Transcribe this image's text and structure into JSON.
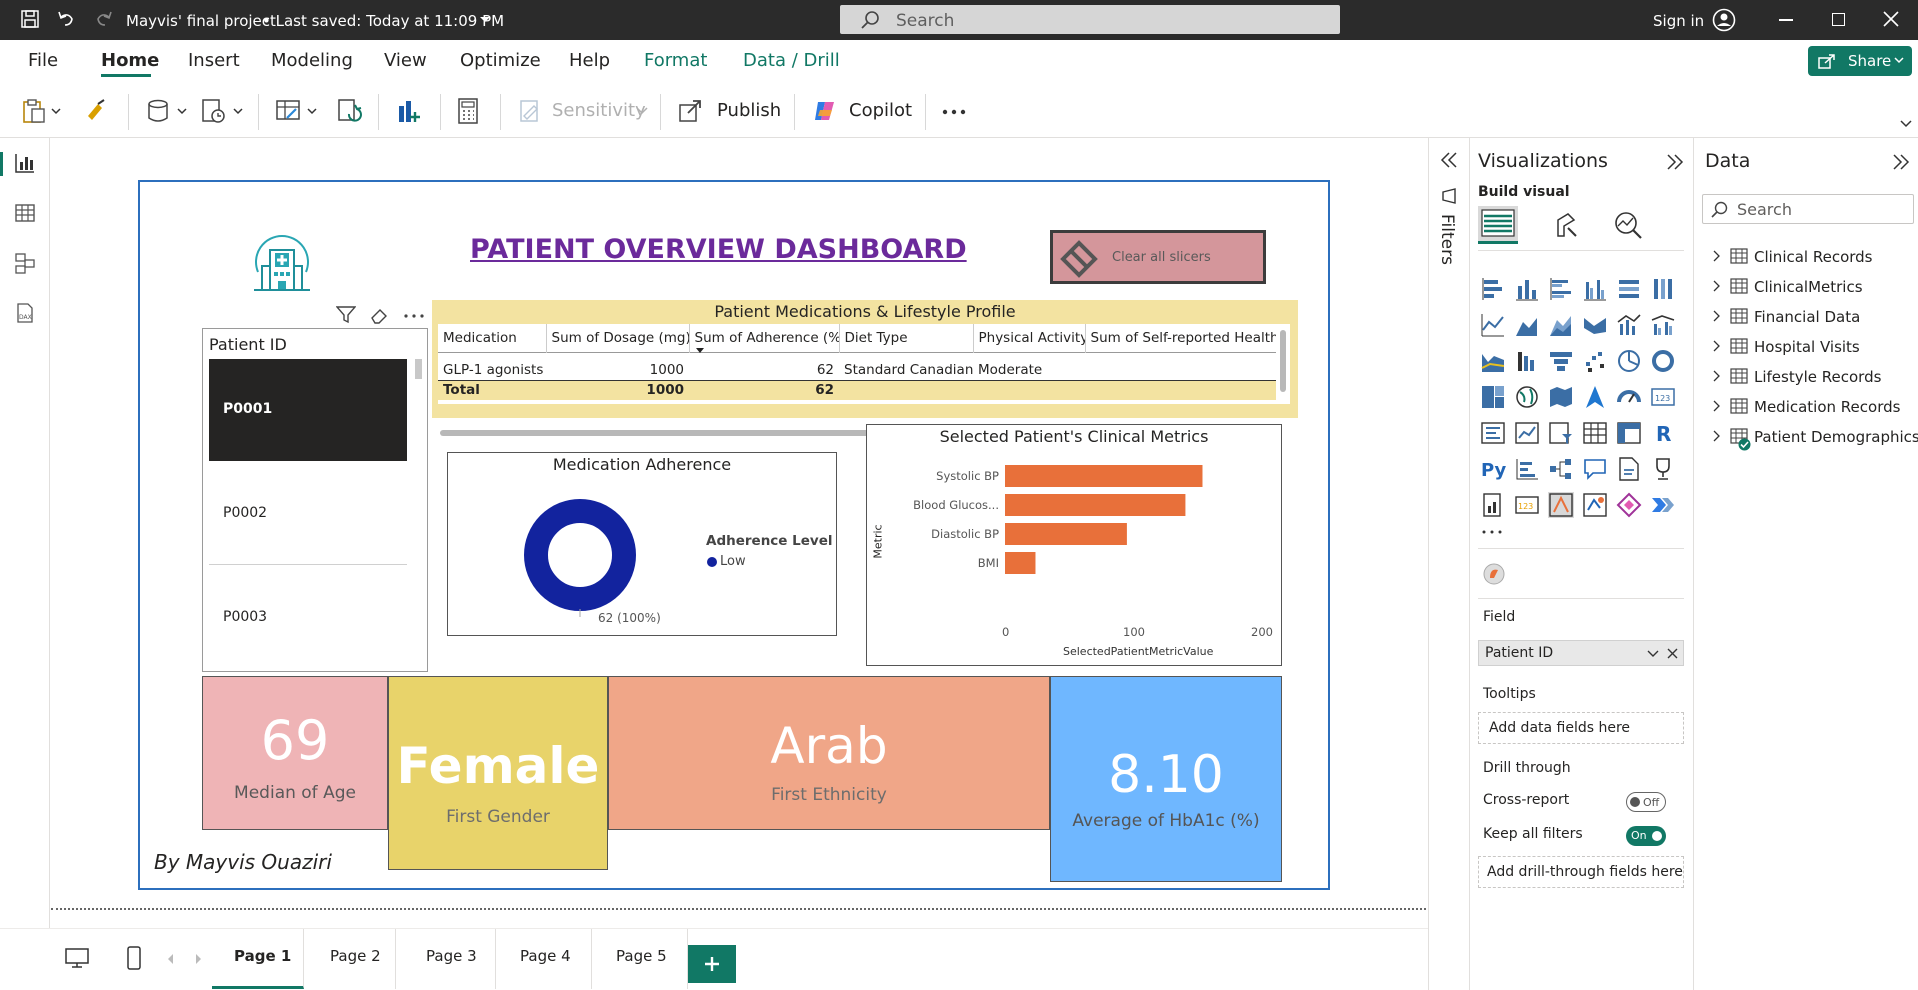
{
  "titlebar": {
    "file_title": "Mayvis' final project",
    "saved_status": "• Last saved: Today at 11:09 PM",
    "search_placeholder": "Search",
    "sign_in": "Sign in"
  },
  "menu": {
    "items": [
      "File",
      "Home",
      "Insert",
      "Modeling",
      "View",
      "Optimize",
      "Help",
      "Format",
      "Data / Drill"
    ],
    "active": "Home",
    "share": "Share"
  },
  "ribbon": {
    "sensitivity": "Sensitivity",
    "publish": "Publish",
    "copilot": "Copilot"
  },
  "report": {
    "title": "PATIENT OVERVIEW DASHBOARD",
    "clear_slicers": "Clear all slicers",
    "slicer": {
      "header": "Patient ID",
      "items": [
        "P0001",
        "P0002",
        "P0003"
      ],
      "selected": "P0001"
    },
    "table": {
      "title": "Patient Medications & Lifestyle Profile",
      "columns": [
        "Medication",
        "Sum of Dosage (mg)",
        "Sum of Adherence (%)",
        "Diet Type",
        "Physical Activity",
        "Sum of Self-reported Health ("
      ],
      "rows": [
        [
          "GLP-1 agonists",
          "1000",
          "62",
          "Standard Canadian",
          "Moderate",
          ""
        ]
      ],
      "total": [
        "Total",
        "1000",
        "62",
        "",
        "",
        ""
      ]
    },
    "donut": {
      "title": "Medication Adherence",
      "legend_title": "Adherence Level",
      "legend_item": "Low",
      "data_label": "62 (100%)"
    },
    "bar": {
      "title": "Selected Patient's Clinical Metrics",
      "y_axis_label": "Metric",
      "x_axis_label": "SelectedPatientMetricValue",
      "x_ticks": [
        "0",
        "100",
        "200"
      ],
      "categories": [
        "Systolic BP",
        "Blood Glucos...",
        "Diastolic BP",
        "BMI"
      ]
    },
    "kpis": [
      {
        "value": "69",
        "label": "Median of Age"
      },
      {
        "value": "Female",
        "label": "First Gender"
      },
      {
        "value": "Arab",
        "label": "First Ethnicity"
      },
      {
        "value": "8.10",
        "label": "Average of HbA1c (%)"
      }
    ],
    "author": "By Mayvis Ouaziri"
  },
  "chart_data": [
    {
      "type": "bar",
      "title": "Selected Patient's Clinical Metrics",
      "categories": [
        "Systolic BP",
        "Blood Glucos...",
        "Diastolic BP",
        "BMI"
      ],
      "values": [
        162,
        148,
        100,
        25
      ],
      "xlabel": "SelectedPatientMetricValue",
      "ylabel": "Metric",
      "xlim": [
        0,
        210
      ],
      "color": "#e8703a"
    },
    {
      "type": "pie",
      "title": "Medication Adherence",
      "categories": [
        "Low"
      ],
      "values": [
        62
      ],
      "color": "#12239e"
    }
  ],
  "pages": {
    "tabs": [
      "Page 1",
      "Page 2",
      "Page 3",
      "Page 4",
      "Page 5"
    ],
    "active": "Page 1"
  },
  "filters": {
    "label": "Filters"
  },
  "visualizations": {
    "title": "Visualizations",
    "build_visual": "Build visual",
    "field_heading": "Field",
    "field_value": "Patient ID",
    "tooltips_heading": "Tooltips",
    "tooltips_placeholder": "Add data fields here",
    "drill_heading": "Drill through",
    "cross_report": "Cross-report",
    "cross_report_state": "Off",
    "keep_filters": "Keep all filters",
    "keep_filters_state": "On",
    "drill_placeholder": "Add drill-through fields here"
  },
  "data": {
    "title": "Data",
    "search_placeholder": "Search",
    "tables": [
      "Clinical Records",
      "ClinicalMetrics",
      "Financial Data",
      "Hospital Visits",
      "Lifestyle Records",
      "Medication Records",
      "Patient Demographics"
    ]
  },
  "colors": {
    "titlebar": "#2b2b2b",
    "accent_green": "#117865",
    "report_border": "#2c6fbd",
    "title_purple": "#6b2a9b",
    "bar_orange": "#e8703a",
    "donut_blue": "#12239e",
    "kpi_pink": "#efb4b6",
    "kpi_yellow": "#e8d36a",
    "kpi_salmon": "#f0a688",
    "kpi_blue": "#6fb7ff",
    "table_header_bg": "#f3e3a1"
  }
}
